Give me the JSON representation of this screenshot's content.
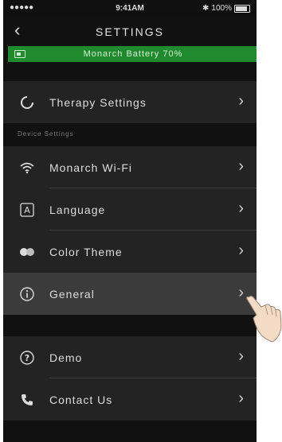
{
  "status_bar": {
    "signal": "●●●●●",
    "time": "9:41AM",
    "bluetooth": "✱",
    "battery": "100%"
  },
  "header": {
    "back_icon": "‹",
    "title": "SETTINGS"
  },
  "battery_banner": {
    "text": "Monarch Battery 70%",
    "color": "#1f8a2e"
  },
  "groups": [
    {
      "items": [
        {
          "label": "Therapy Settings",
          "icon": "ring-icon"
        }
      ]
    },
    {
      "section_label": "Device Settings",
      "items": [
        {
          "label": "Monarch Wi-Fi",
          "icon": "wifi-icon"
        },
        {
          "label": "Language",
          "icon": "language-icon"
        },
        {
          "label": "Color Theme",
          "icon": "color-theme-icon"
        },
        {
          "label": "General",
          "icon": "info-icon",
          "selected": true
        }
      ]
    },
    {
      "items": [
        {
          "label": "Demo",
          "icon": "help-icon"
        },
        {
          "label": "Contact Us",
          "icon": "phone-icon"
        }
      ]
    }
  ],
  "chevron": "›"
}
